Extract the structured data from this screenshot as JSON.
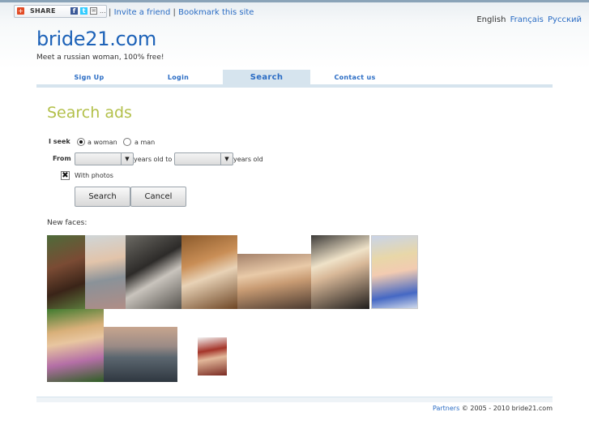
{
  "share": {
    "label": "SHARE",
    "f": "f",
    "t": "t",
    "mail": "✉",
    "more": "..."
  },
  "toplinks": {
    "sep": "|",
    "invite": "Invite a friend",
    "bookmark": "Bookmark this site"
  },
  "languages": {
    "english": "English",
    "french": "Français",
    "russian": "Русский"
  },
  "site": {
    "logo": "bride21.com",
    "tagline": "Meet a russian woman, 100% free!"
  },
  "nav": {
    "items": [
      {
        "label": "Sign Up"
      },
      {
        "label": "Login"
      },
      {
        "label": "Search",
        "active": true
      },
      {
        "label": "Contact us"
      }
    ]
  },
  "search": {
    "title": "Search ads",
    "seek_label": "I seek",
    "option_woman": "a woman",
    "option_man": "a man",
    "selected": "a woman",
    "from_label": "From",
    "age_min": "",
    "age_max": "",
    "years_to": "years old to",
    "years_old": "years old",
    "with_photos_label": "With photos",
    "with_photos_checked": true,
    "search_button": "Search",
    "cancel_button": "Cancel"
  },
  "new_faces": {
    "label": "New faces:"
  },
  "footer": {
    "partners": "Partners",
    "copyright": "© 2005 - 2010 bride21.com"
  },
  "colors": {
    "accent": "#2a6cc4",
    "title": "#b3c04a",
    "nav_bg": "#d6e4ee"
  }
}
